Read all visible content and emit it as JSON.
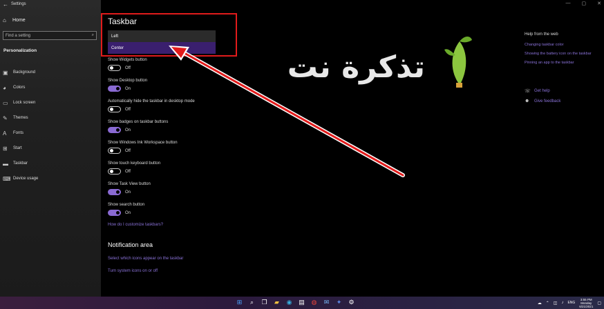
{
  "window": {
    "title": "Settings",
    "back_icon": "back-arrow-icon",
    "controls": [
      "—",
      "▢",
      "✕"
    ]
  },
  "sidebar": {
    "home_label": "Home",
    "search_placeholder": "Find a setting",
    "section_label": "Personalization",
    "items": [
      {
        "label": "Background",
        "icon": "image-icon"
      },
      {
        "label": "Colors",
        "icon": "palette-icon"
      },
      {
        "label": "Lock screen",
        "icon": "monitor-icon"
      },
      {
        "label": "Themes",
        "icon": "brush-icon"
      },
      {
        "label": "Fonts",
        "icon": "font-icon"
      },
      {
        "label": "Start",
        "icon": "start-icon"
      },
      {
        "label": "Taskbar",
        "icon": "taskbar-icon"
      },
      {
        "label": "Device usage",
        "icon": "device-icon"
      }
    ]
  },
  "main": {
    "title": "Taskbar",
    "alignment_options": [
      "Left",
      "Center"
    ],
    "alignment_selected": "Center",
    "settings": [
      {
        "label": "Show Widgets button",
        "state": "Off"
      },
      {
        "label": "Show Desktop button",
        "state": "On"
      },
      {
        "label": "Automatically hide the taskbar in desktop mode",
        "state": "Off"
      },
      {
        "label": "Show badges on taskbar buttons",
        "state": "On"
      },
      {
        "label": "Show Windows Ink Workspace button",
        "state": "Off"
      },
      {
        "label": "Show touch keyboard button",
        "state": "Off"
      },
      {
        "label": "Show Task View button",
        "state": "On"
      },
      {
        "label": "Show search button",
        "state": "On"
      }
    ],
    "customize_link": "How do I customize taskbars?",
    "notification_title": "Notification area",
    "notification_links": [
      "Select which icons appear on the taskbar",
      "Turn system icons on or off"
    ]
  },
  "help": {
    "title": "Help from the web",
    "links": [
      "Changing taskbar color",
      "Showing the battery icon on the taskbar",
      "Pinning an app to the taskbar"
    ],
    "get_help": "Get help",
    "give_feedback": "Give feedback"
  },
  "watermark": {
    "text": "تذكرة نت"
  },
  "taskbar": {
    "clock_time": "3:55 PM",
    "clock_day": "Monday",
    "clock_date": "6/21/2021",
    "language": "ENG"
  },
  "colors": {
    "accent": "#8a6ad3",
    "highlight": "#e21b1b",
    "link": "#8a72d8"
  }
}
